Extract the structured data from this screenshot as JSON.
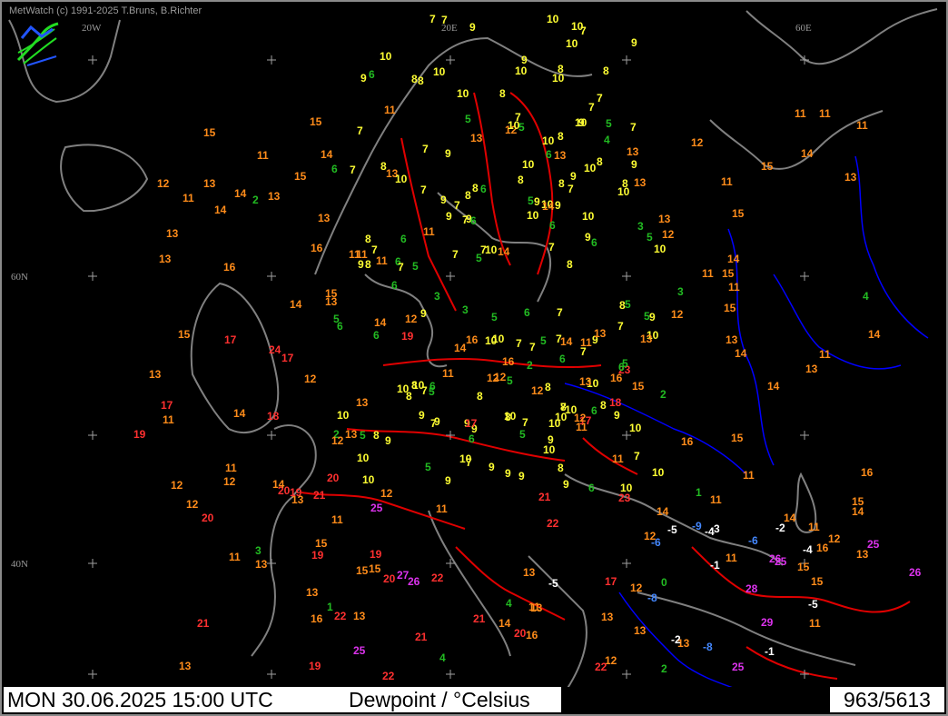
{
  "header": {
    "copyright": "MetWatch (c) 1991-2025 T.Bruns, B.Richter"
  },
  "status_bar": {
    "datetime": "MON 30.06.2025 15:00 UTC",
    "parameter": "Dewpoint / °Celsius",
    "station_count": "963/5613"
  },
  "map": {
    "grid_labels": [
      "20W",
      "20E",
      "60E",
      "60N",
      "40N"
    ],
    "colors": {
      "background": "#000000",
      "coastline": "#808080",
      "borders": "#e00000",
      "rivers": "#0000ff",
      "grid_cross": "#a0a0a0"
    },
    "value_color_scale": [
      {
        "range": "below -5",
        "color": "#4488ff"
      },
      {
        "range": "-5 to -1",
        "color": "#ffffff"
      },
      {
        "range": "0 to 6",
        "color": "#22bb22"
      },
      {
        "range": "7 to 10",
        "color": "#ffff33"
      },
      {
        "range": "11 to 16",
        "color": "#ff8c1a"
      },
      {
        "range": "17 to 24",
        "color": "#ff3030"
      },
      {
        "range": "25 and above",
        "color": "#dd33ee"
      }
    ],
    "observations": [
      "3",
      "2",
      "1",
      "1",
      "8",
      "9",
      "7",
      "5",
      "10",
      "9",
      "8",
      "7",
      "7",
      "10",
      "9",
      "7",
      "8",
      "7",
      "5",
      "10",
      "9",
      "8",
      "10",
      "8",
      "9",
      "9",
      "8",
      "7",
      "7",
      "9",
      "8",
      "10",
      "7",
      "5",
      "6",
      "8",
      "7",
      "11",
      "5",
      "6",
      "9",
      "6",
      "5",
      "5",
      "10",
      "9",
      "7",
      "10",
      "6",
      "10",
      "7",
      "10",
      "7",
      "8",
      "7",
      "8",
      "7",
      "6",
      "7",
      "6",
      "7",
      "7",
      "5",
      "5",
      "7",
      "10",
      "10",
      "7",
      "6",
      "12",
      "12",
      "15",
      "14",
      "15",
      "13",
      "11",
      "12",
      "8",
      "7",
      "5",
      "9",
      "6",
      "7",
      "8",
      "6",
      "9",
      "5",
      "9",
      "16",
      "9",
      "11",
      "15",
      "13",
      "8",
      "7",
      "8",
      "7",
      "7",
      "6",
      "7",
      "8",
      "6",
      "10",
      "7",
      "13",
      "17",
      "15",
      "10",
      "11",
      "8",
      "9",
      "5",
      "9",
      "9",
      "9",
      "6",
      "6",
      "13",
      "11",
      "6",
      "15",
      "13",
      "11",
      "15",
      "16",
      "14",
      "9",
      "11",
      "13",
      "8",
      "9",
      "10",
      "13",
      "10",
      "7",
      "13",
      "17",
      "8",
      "5",
      "10",
      "14",
      "11",
      "10",
      "12",
      "10",
      "13",
      "11",
      "13",
      "13",
      "11",
      "10",
      "10",
      "12",
      "14",
      "11",
      "11",
      "14",
      "11",
      "10",
      "15",
      "13",
      "10",
      "16",
      "13",
      "15",
      "15",
      "13",
      "12",
      "14",
      "14",
      "13",
      "11",
      "12",
      "10",
      "11",
      "10",
      "10",
      "9",
      "10",
      "11",
      "11",
      "13",
      "11",
      "14",
      "16",
      "15",
      "14",
      "12",
      "13",
      "12",
      "13",
      "11",
      "12",
      "15",
      "13",
      "14",
      "14",
      "15",
      "14",
      "16",
      "15",
      "17",
      "16",
      "19",
      "17",
      "19",
      "16",
      "19",
      "19",
      "21",
      "20",
      "21",
      "20",
      "19",
      "21",
      "22",
      "23",
      "20",
      "22",
      "22",
      "23",
      "22",
      "20",
      "21",
      "24",
      "25",
      "25",
      "26",
      "25",
      "26",
      "26",
      "27",
      "28",
      "29",
      "25",
      "25",
      "-6",
      "-1",
      "-5",
      "-5",
      "-1",
      "-2",
      "-4",
      "-4",
      "-5",
      "-6",
      "-8",
      "-8",
      "-9",
      "-2",
      "-3",
      "3",
      "2",
      "4",
      "5",
      "4",
      "3",
      "2",
      "5",
      "4",
      "3",
      "2",
      "4",
      "3",
      "5",
      "2",
      "6",
      "0",
      "13",
      "12",
      "11",
      "14",
      "8",
      "13",
      "13",
      "12",
      "10",
      "10",
      "11",
      "13",
      "14",
      "8",
      "12",
      "9",
      "11",
      "16",
      "18",
      "17",
      "13",
      "21",
      "20",
      "19",
      "22",
      "15",
      "14",
      "12",
      "10",
      "11",
      "13",
      "8",
      "7",
      "9",
      "5",
      "6",
      "10",
      "8",
      "9",
      "6",
      "5",
      "8",
      "9",
      "7",
      "6",
      "11",
      "10",
      "12",
      "13",
      "10",
      "9",
      "8",
      "7",
      "9",
      "10",
      "11",
      "12",
      "10",
      "9",
      "9",
      "8",
      "7",
      "6",
      "5",
      "9",
      "10",
      "14",
      "13",
      "15",
      "12",
      "17",
      "16",
      "18",
      "16",
      "15",
      "14",
      "13",
      "15",
      "14",
      "13",
      "12",
      "11",
      "13",
      "12",
      "10",
      "11",
      "9",
      "8",
      "10",
      "11",
      "13",
      "14",
      "10",
      "14",
      "12",
      "13",
      "11"
    ]
  }
}
